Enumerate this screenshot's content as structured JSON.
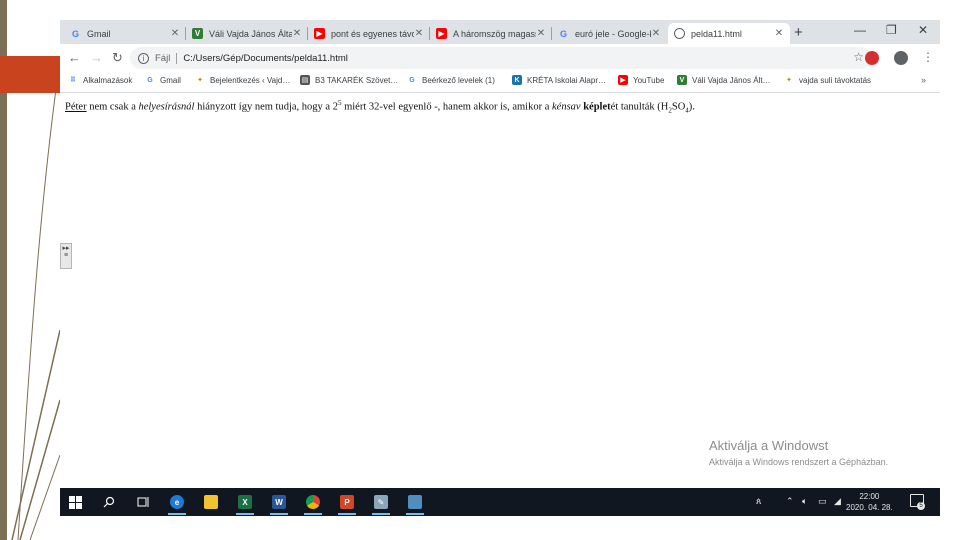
{
  "tabs": [
    {
      "label": "Gmail",
      "icon": "google-icon",
      "color": "#ffffff"
    },
    {
      "label": "Váli Vajda János Általá",
      "icon": "school-logo-icon",
      "color": "#2e7d32"
    },
    {
      "label": "pont és egyenes távo",
      "icon": "youtube-icon",
      "color": "#ff0000"
    },
    {
      "label": "A háromszög magass",
      "icon": "youtube-icon",
      "color": "#ff0000"
    },
    {
      "label": "euró jele - Google-ker",
      "icon": "google-icon",
      "color": "#ffffff"
    },
    {
      "label": "pelda11.html",
      "icon": "globe-icon",
      "color": "#5f6368"
    }
  ],
  "address_bar": {
    "scheme_label": "Fájl",
    "url": "C:/Users/Gép/Documents/pelda11.html"
  },
  "bookmarks": [
    {
      "label": "Alkalmazások",
      "icon": "apps-grid-icon"
    },
    {
      "label": "Gmail",
      "icon": "google-icon"
    },
    {
      "label": "Bejelentkezés ‹ Vajd…",
      "icon": "vajda-logo-icon"
    },
    {
      "label": "B3 TAKARÉK Szövet…",
      "icon": "bank-icon"
    },
    {
      "label": "Beérkező levelek (1)",
      "icon": "google-icon"
    },
    {
      "label": "KRÉTA Iskolai Alapr…",
      "icon": "kreta-icon"
    },
    {
      "label": "YouTube",
      "icon": "youtube-icon"
    },
    {
      "label": "Váli Vajda János Ált…",
      "icon": "school-logo-icon"
    },
    {
      "label": "vajda suli távoktatás",
      "icon": "vajda-logo-icon"
    }
  ],
  "bookmarks_more": "»",
  "document": {
    "name": "Péter",
    "t1": " nem csak a ",
    "em1": "helyesírásnál",
    "t2": " hiányzott    így nem tudja, hogy a 2",
    "sup": "5",
    "t3": " miért 32-vel egyenlő -, hanem akkor is, amikor a ",
    "em2": "kénsav",
    "t4": " ",
    "strong1": "képlet",
    "t5": "ét tanulták (H",
    "sub1": "2",
    "t6": "SO",
    "sub2": "4",
    "t7": ")."
  },
  "watermark": {
    "line1": "Aktiválja a Windowst",
    "line2": "Aktiválja a Windows rendszert a Gépházban."
  },
  "taskbar": {
    "clock_time": "22:00",
    "clock_date": "2020. 04. 28.",
    "notification_count": "5"
  },
  "colors": {
    "slide_accent": "#c8431e",
    "taskbar_bg": "#101720",
    "tabbar_bg": "#dee1e6"
  }
}
